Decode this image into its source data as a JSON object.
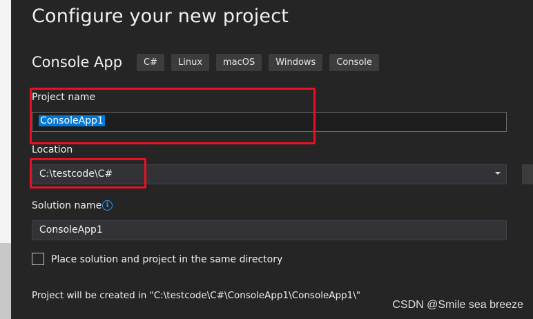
{
  "header": {
    "title": "Configure your new project",
    "template_name": "Console App",
    "tags": [
      "C#",
      "Linux",
      "macOS",
      "Windows",
      "Console"
    ]
  },
  "form": {
    "project_name_label": "Project name",
    "project_name_value": "ConsoleApp1",
    "location_label": "Location",
    "location_value": "C:\\testcode\\C#",
    "solution_name_label": "Solution name",
    "solution_name_value": "ConsoleApp1",
    "same_directory_label": "Place solution and project in the same directory",
    "same_directory_checked": false,
    "created_path_note": "Project will be created in \"C:\\testcode\\C#\\ConsoleApp1\\ConsoleApp1\\\""
  },
  "watermark": "CSDN @Smile sea breeze",
  "colors": {
    "background": "#252526",
    "field_bg": "#333337",
    "selection": "#0078d7",
    "highlight": "#e81123",
    "info": "#3794ff"
  },
  "icons": [
    "info-icon",
    "chevron-down-icon"
  ]
}
